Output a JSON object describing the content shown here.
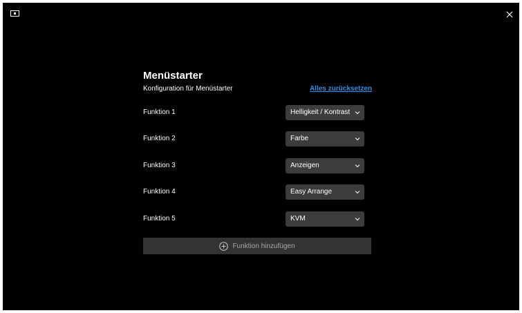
{
  "window": {
    "app_icon": "monitor-icon",
    "close_icon": "close-icon"
  },
  "panel": {
    "title": "Menüstarter",
    "subtitle": "Konfiguration für Menüstarter",
    "reset_link": "Alles zurücksetzen"
  },
  "functions": [
    {
      "label": "Funktion 1",
      "value": "Helligkeit / Kontrast"
    },
    {
      "label": "Funktion 2",
      "value": "Farbe"
    },
    {
      "label": "Funktion 3",
      "value": "Anzeigen"
    },
    {
      "label": "Funktion 4",
      "value": "Easy Arrange"
    },
    {
      "label": "Funktion 5",
      "value": "KVM"
    }
  ],
  "add_button": {
    "label": "Funktion hinzufügen",
    "icon": "plus-circle-icon"
  },
  "colors": {
    "background": "#000000",
    "dropdown_bg": "#3c3c3c",
    "link": "#2e8fe6",
    "add_button_bg": "#333333",
    "add_button_text": "#a8a8a8"
  }
}
